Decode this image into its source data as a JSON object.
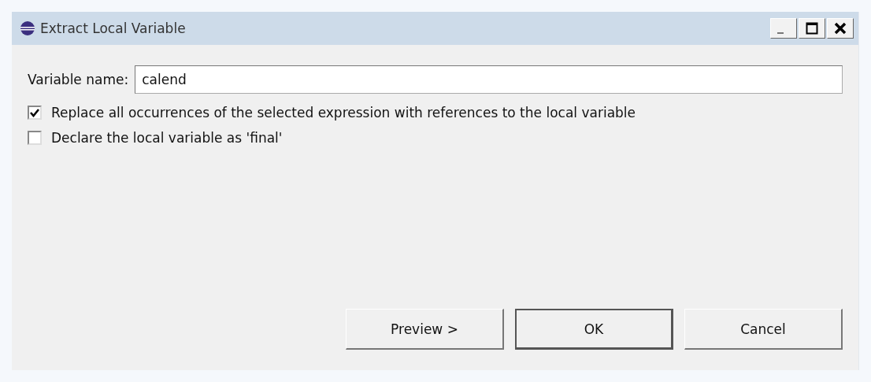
{
  "window": {
    "title": "Extract Local Variable"
  },
  "variable_name": {
    "label": "Variable name:",
    "value": "calend"
  },
  "options": [
    {
      "label": "Replace all occurrences of the selected expression with references to the local variable",
      "checked": true
    },
    {
      "label": "Declare the local variable as 'final'",
      "checked": false
    }
  ],
  "buttons": [
    {
      "label": "Preview >",
      "default": false
    },
    {
      "label": "OK",
      "default": true
    },
    {
      "label": "Cancel",
      "default": false
    }
  ]
}
